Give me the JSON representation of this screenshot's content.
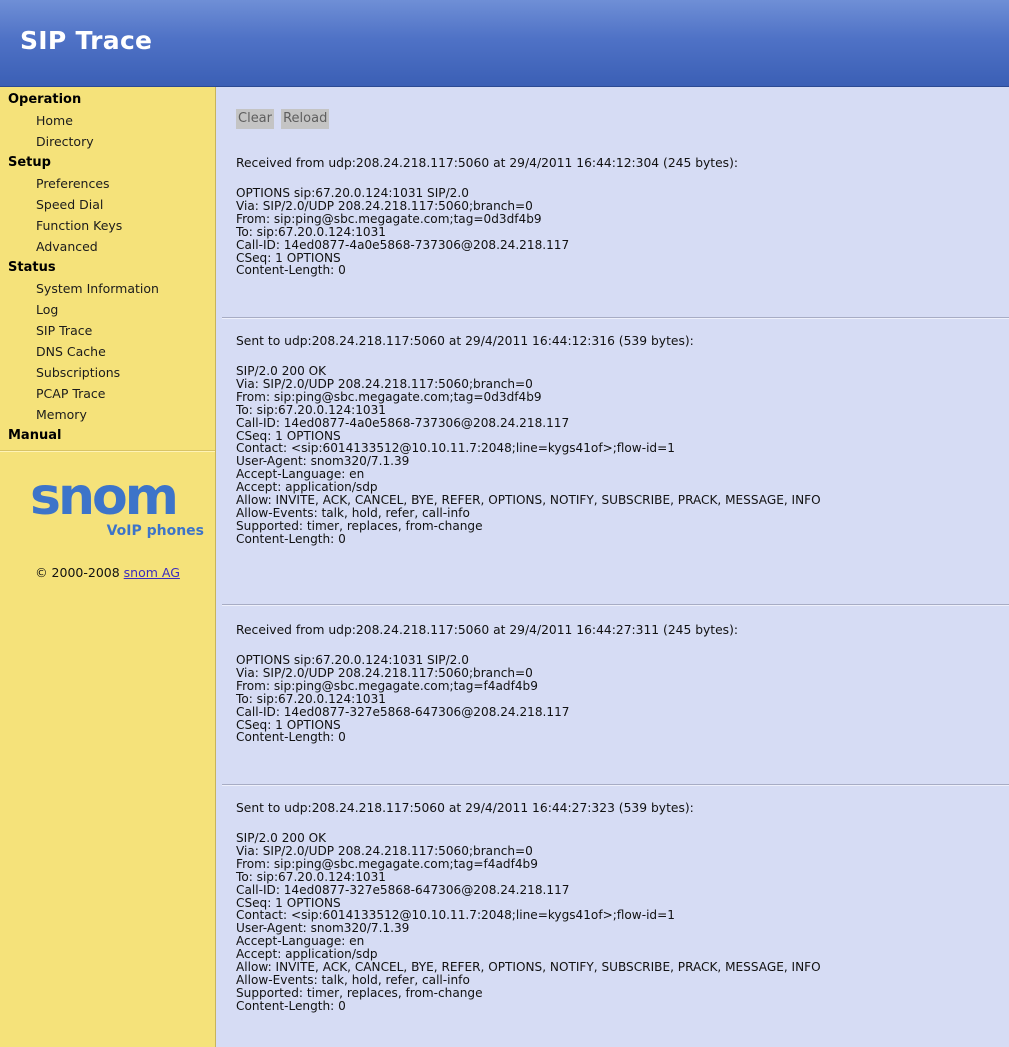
{
  "page_title": "SIP Trace",
  "sidebar": {
    "sections": [
      {
        "label": "Operation",
        "items": [
          "Home",
          "Directory"
        ]
      },
      {
        "label": "Setup",
        "items": [
          "Preferences",
          "Speed Dial",
          "Function Keys",
          "Advanced"
        ]
      },
      {
        "label": "Status",
        "items": [
          "System Information",
          "Log",
          "SIP Trace",
          "DNS Cache",
          "Subscriptions",
          "PCAP Trace",
          "Memory"
        ]
      },
      {
        "label": "Manual",
        "items": []
      }
    ],
    "logo": {
      "brand": "snom",
      "tagline": "VoIP phones"
    },
    "copyright_text": "© 2000-2008",
    "copyright_link": "snom AG"
  },
  "toolbar": {
    "clear_label": "Clear",
    "reload_label": "Reload"
  },
  "messages": [
    {
      "header": "Received from udp:208.24.218.117:5060 at 29/4/2011 16:44:12:304 (245 bytes):",
      "lines": [
        "OPTIONS sip:67.20.0.124:1031 SIP/2.0",
        "Via: SIP/2.0/UDP 208.24.218.117:5060;branch=0",
        "From: sip:ping@sbc.megagate.com;tag=0d3df4b9",
        "To: sip:67.20.0.124:1031",
        "Call-ID: 14ed0877-4a0e5868-737306@208.24.218.117",
        "CSeq: 1 OPTIONS",
        "Content-Length: 0"
      ]
    },
    {
      "header": "Sent to udp:208.24.218.117:5060 at 29/4/2011 16:44:12:316 (539 bytes):",
      "lines": [
        "SIP/2.0 200 OK",
        "Via: SIP/2.0/UDP 208.24.218.117:5060;branch=0",
        "From: sip:ping@sbc.megagate.com;tag=0d3df4b9",
        "To: sip:67.20.0.124:1031",
        "Call-ID: 14ed0877-4a0e5868-737306@208.24.218.117",
        "CSeq: 1 OPTIONS",
        "Contact: <sip:6014133512@10.10.11.7:2048;line=kygs41of>;flow-id=1",
        "User-Agent: snom320/7.1.39",
        "Accept-Language: en",
        "Accept: application/sdp",
        "Allow: INVITE, ACK, CANCEL, BYE, REFER, OPTIONS, NOTIFY, SUBSCRIBE, PRACK, MESSAGE, INFO",
        "Allow-Events: talk, hold, refer, call-info",
        "Supported: timer, replaces, from-change",
        "Content-Length: 0"
      ]
    },
    {
      "header": "Received from udp:208.24.218.117:5060 at 29/4/2011 16:44:27:311 (245 bytes):",
      "lines": [
        "OPTIONS sip:67.20.0.124:1031 SIP/2.0",
        "Via: SIP/2.0/UDP 208.24.218.117:5060;branch=0",
        "From: sip:ping@sbc.megagate.com;tag=f4adf4b9",
        "To: sip:67.20.0.124:1031",
        "Call-ID: 14ed0877-327e5868-647306@208.24.218.117",
        "CSeq: 1 OPTIONS",
        "Content-Length: 0"
      ]
    },
    {
      "header": "Sent to udp:208.24.218.117:5060 at 29/4/2011 16:44:27:323 (539 bytes):",
      "lines": [
        "SIP/2.0 200 OK",
        "Via: SIP/2.0/UDP 208.24.218.117:5060;branch=0",
        "From: sip:ping@sbc.megagate.com;tag=f4adf4b9",
        "To: sip:67.20.0.124:1031",
        "Call-ID: 14ed0877-327e5868-647306@208.24.218.117",
        "CSeq: 1 OPTIONS",
        "Contact: <sip:6014133512@10.10.11.7:2048;line=kygs41of>;flow-id=1",
        "User-Agent: snom320/7.1.39",
        "Accept-Language: en",
        "Accept: application/sdp",
        "Allow: INVITE, ACK, CANCEL, BYE, REFER, OPTIONS, NOTIFY, SUBSCRIBE, PRACK, MESSAGE, INFO",
        "Allow-Events: talk, hold, refer, call-info",
        "Supported: timer, replaces, from-change",
        "Content-Length: 0"
      ]
    }
  ],
  "colors": {
    "header_blue": "#4f72c6",
    "sidebar_yellow": "#f5e27a",
    "content_bg": "#d6dcf4",
    "logo_blue": "#3d74c9",
    "link_purple": "#3b2bbf"
  }
}
